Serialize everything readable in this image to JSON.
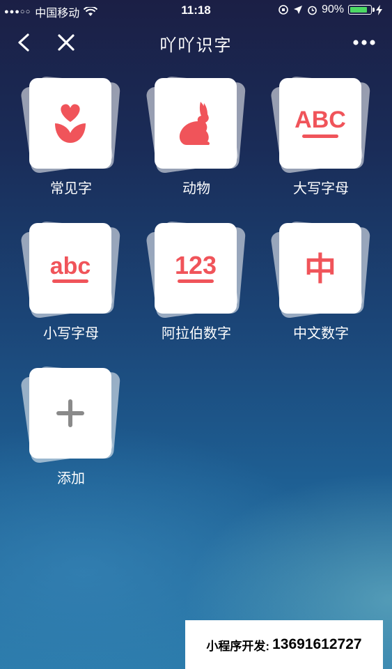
{
  "status_bar": {
    "signal_dots": "●●●○○",
    "carrier": "中国移动",
    "time": "11:18",
    "battery_text": "90%",
    "battery_level": 0.9,
    "icons": [
      "signal-icon",
      "wifi-icon",
      "orientation-lock-icon",
      "location-icon",
      "alarm-icon",
      "battery-icon",
      "charging-icon"
    ]
  },
  "nav": {
    "title": "吖吖识字",
    "icons": [
      "back-chevron-icon",
      "close-icon",
      "more-dots-icon"
    ]
  },
  "tiles": [
    {
      "label": "常见字",
      "icon": "tulip-heart-icon"
    },
    {
      "label": "动物",
      "icon": "rabbit-icon"
    },
    {
      "label": "大写字母",
      "icon_text": "ABC"
    },
    {
      "label": "小写字母",
      "icon_text": "abc"
    },
    {
      "label": "阿拉伯数字",
      "icon_text": "123"
    },
    {
      "label": "中文数字",
      "icon_text": "中"
    },
    {
      "label": "添加",
      "icon": "plus-icon"
    }
  ],
  "colors": {
    "accent": "#f0545a",
    "plus": "#8a8a8a",
    "battery": "#4cd964"
  },
  "watermark": {
    "prefix": "小程序开发:",
    "phone": "13691612727"
  }
}
